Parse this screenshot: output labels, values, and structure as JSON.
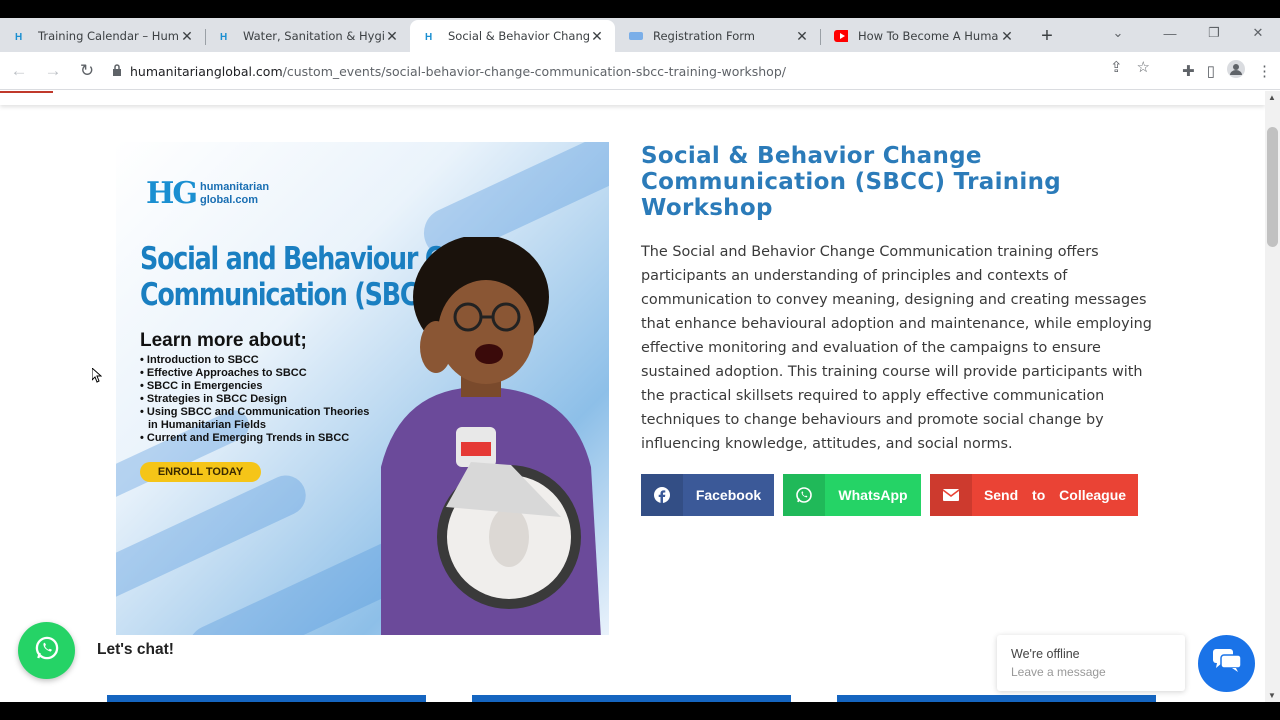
{
  "browser": {
    "tabs": [
      {
        "title": "Training Calendar – Humanit",
        "favicon": "hg-favicon",
        "active": false
      },
      {
        "title": "Water, Sanitation & Hygiene",
        "favicon": "hg-favicon",
        "active": false
      },
      {
        "title": "Social & Behavior Change C",
        "favicon": "hg-favicon",
        "active": true
      },
      {
        "title": "Registration Form",
        "favicon": "form-favicon",
        "active": false
      },
      {
        "title": "How To Become A Humanita",
        "favicon": "youtube-favicon",
        "active": false
      }
    ],
    "url_host": "humanitarianglobal.com",
    "url_path": "/custom_events/social-behavior-change-communication-sbcc-training-workshop/"
  },
  "banner": {
    "logo_line1": "humanitarian",
    "logo_line2": "global.com",
    "heading_line1": "Social and Behaviour Change",
    "heading_line2": "Communication (SBCC)",
    "learn_more": "Learn more about;",
    "topics": [
      "Introduction to SBCC",
      "Effective Approaches to SBCC",
      "SBCC in Emergencies",
      "Strategies in SBCC Design",
      "Using SBCC and Communication Theories",
      "in Humanitarian Fields",
      "Current and Emerging Trends in SBCC"
    ],
    "enroll": "ENROLL TODAY"
  },
  "event": {
    "title": "Social & Behavior Change Communication (SBCC) Training Workshop",
    "description": "The Social and Behavior Change Communication training offers participants an understanding of principles and contexts of communication to convey meaning, designing and creating messages that enhance behavioural adoption and maintenance, while employing effective monitoring and evaluation of the campaigns to ensure sustained adoption. This training course will provide participants with the practical skillsets required to apply effective communication techniques to change behaviours and promote social change by influencing knowledge, attitudes, and social norms."
  },
  "share": {
    "facebook": "Facebook",
    "whatsapp": "WhatsApp",
    "email": "Send to Colleague"
  },
  "widgets": {
    "lets_chat": "Let's chat!",
    "offline_title": "We're offline",
    "offline_sub": "Leave a message"
  },
  "colors": {
    "title_blue": "#2b7bb9",
    "facebook": "#3b5998",
    "whatsapp": "#25d366",
    "email": "#ea4335"
  }
}
